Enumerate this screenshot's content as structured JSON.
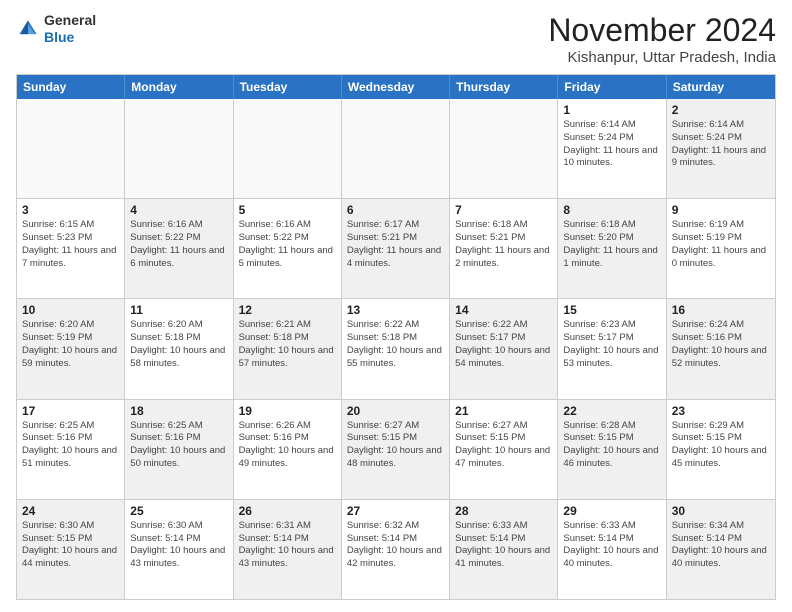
{
  "logo": {
    "general": "General",
    "blue": "Blue"
  },
  "header": {
    "title": "November 2024",
    "location": "Kishanpur, Uttar Pradesh, India"
  },
  "weekdays": [
    "Sunday",
    "Monday",
    "Tuesday",
    "Wednesday",
    "Thursday",
    "Friday",
    "Saturday"
  ],
  "rows": [
    [
      {
        "day": "",
        "info": "",
        "shaded": false,
        "empty": true
      },
      {
        "day": "",
        "info": "",
        "shaded": false,
        "empty": true
      },
      {
        "day": "",
        "info": "",
        "shaded": false,
        "empty": true
      },
      {
        "day": "",
        "info": "",
        "shaded": false,
        "empty": true
      },
      {
        "day": "",
        "info": "",
        "shaded": false,
        "empty": true
      },
      {
        "day": "1",
        "info": "Sunrise: 6:14 AM\nSunset: 5:24 PM\nDaylight: 11 hours and 10 minutes.",
        "shaded": false,
        "empty": false
      },
      {
        "day": "2",
        "info": "Sunrise: 6:14 AM\nSunset: 5:24 PM\nDaylight: 11 hours and 9 minutes.",
        "shaded": true,
        "empty": false
      }
    ],
    [
      {
        "day": "3",
        "info": "Sunrise: 6:15 AM\nSunset: 5:23 PM\nDaylight: 11 hours and 7 minutes.",
        "shaded": false,
        "empty": false
      },
      {
        "day": "4",
        "info": "Sunrise: 6:16 AM\nSunset: 5:22 PM\nDaylight: 11 hours and 6 minutes.",
        "shaded": true,
        "empty": false
      },
      {
        "day": "5",
        "info": "Sunrise: 6:16 AM\nSunset: 5:22 PM\nDaylight: 11 hours and 5 minutes.",
        "shaded": false,
        "empty": false
      },
      {
        "day": "6",
        "info": "Sunrise: 6:17 AM\nSunset: 5:21 PM\nDaylight: 11 hours and 4 minutes.",
        "shaded": true,
        "empty": false
      },
      {
        "day": "7",
        "info": "Sunrise: 6:18 AM\nSunset: 5:21 PM\nDaylight: 11 hours and 2 minutes.",
        "shaded": false,
        "empty": false
      },
      {
        "day": "8",
        "info": "Sunrise: 6:18 AM\nSunset: 5:20 PM\nDaylight: 11 hours and 1 minute.",
        "shaded": true,
        "empty": false
      },
      {
        "day": "9",
        "info": "Sunrise: 6:19 AM\nSunset: 5:19 PM\nDaylight: 11 hours and 0 minutes.",
        "shaded": false,
        "empty": false
      }
    ],
    [
      {
        "day": "10",
        "info": "Sunrise: 6:20 AM\nSunset: 5:19 PM\nDaylight: 10 hours and 59 minutes.",
        "shaded": true,
        "empty": false
      },
      {
        "day": "11",
        "info": "Sunrise: 6:20 AM\nSunset: 5:18 PM\nDaylight: 10 hours and 58 minutes.",
        "shaded": false,
        "empty": false
      },
      {
        "day": "12",
        "info": "Sunrise: 6:21 AM\nSunset: 5:18 PM\nDaylight: 10 hours and 57 minutes.",
        "shaded": true,
        "empty": false
      },
      {
        "day": "13",
        "info": "Sunrise: 6:22 AM\nSunset: 5:18 PM\nDaylight: 10 hours and 55 minutes.",
        "shaded": false,
        "empty": false
      },
      {
        "day": "14",
        "info": "Sunrise: 6:22 AM\nSunset: 5:17 PM\nDaylight: 10 hours and 54 minutes.",
        "shaded": true,
        "empty": false
      },
      {
        "day": "15",
        "info": "Sunrise: 6:23 AM\nSunset: 5:17 PM\nDaylight: 10 hours and 53 minutes.",
        "shaded": false,
        "empty": false
      },
      {
        "day": "16",
        "info": "Sunrise: 6:24 AM\nSunset: 5:16 PM\nDaylight: 10 hours and 52 minutes.",
        "shaded": true,
        "empty": false
      }
    ],
    [
      {
        "day": "17",
        "info": "Sunrise: 6:25 AM\nSunset: 5:16 PM\nDaylight: 10 hours and 51 minutes.",
        "shaded": false,
        "empty": false
      },
      {
        "day": "18",
        "info": "Sunrise: 6:25 AM\nSunset: 5:16 PM\nDaylight: 10 hours and 50 minutes.",
        "shaded": true,
        "empty": false
      },
      {
        "day": "19",
        "info": "Sunrise: 6:26 AM\nSunset: 5:16 PM\nDaylight: 10 hours and 49 minutes.",
        "shaded": false,
        "empty": false
      },
      {
        "day": "20",
        "info": "Sunrise: 6:27 AM\nSunset: 5:15 PM\nDaylight: 10 hours and 48 minutes.",
        "shaded": true,
        "empty": false
      },
      {
        "day": "21",
        "info": "Sunrise: 6:27 AM\nSunset: 5:15 PM\nDaylight: 10 hours and 47 minutes.",
        "shaded": false,
        "empty": false
      },
      {
        "day": "22",
        "info": "Sunrise: 6:28 AM\nSunset: 5:15 PM\nDaylight: 10 hours and 46 minutes.",
        "shaded": true,
        "empty": false
      },
      {
        "day": "23",
        "info": "Sunrise: 6:29 AM\nSunset: 5:15 PM\nDaylight: 10 hours and 45 minutes.",
        "shaded": false,
        "empty": false
      }
    ],
    [
      {
        "day": "24",
        "info": "Sunrise: 6:30 AM\nSunset: 5:15 PM\nDaylight: 10 hours and 44 minutes.",
        "shaded": true,
        "empty": false
      },
      {
        "day": "25",
        "info": "Sunrise: 6:30 AM\nSunset: 5:14 PM\nDaylight: 10 hours and 43 minutes.",
        "shaded": false,
        "empty": false
      },
      {
        "day": "26",
        "info": "Sunrise: 6:31 AM\nSunset: 5:14 PM\nDaylight: 10 hours and 43 minutes.",
        "shaded": true,
        "empty": false
      },
      {
        "day": "27",
        "info": "Sunrise: 6:32 AM\nSunset: 5:14 PM\nDaylight: 10 hours and 42 minutes.",
        "shaded": false,
        "empty": false
      },
      {
        "day": "28",
        "info": "Sunrise: 6:33 AM\nSunset: 5:14 PM\nDaylight: 10 hours and 41 minutes.",
        "shaded": true,
        "empty": false
      },
      {
        "day": "29",
        "info": "Sunrise: 6:33 AM\nSunset: 5:14 PM\nDaylight: 10 hours and 40 minutes.",
        "shaded": false,
        "empty": false
      },
      {
        "day": "30",
        "info": "Sunrise: 6:34 AM\nSunset: 5:14 PM\nDaylight: 10 hours and 40 minutes.",
        "shaded": true,
        "empty": false
      }
    ]
  ]
}
